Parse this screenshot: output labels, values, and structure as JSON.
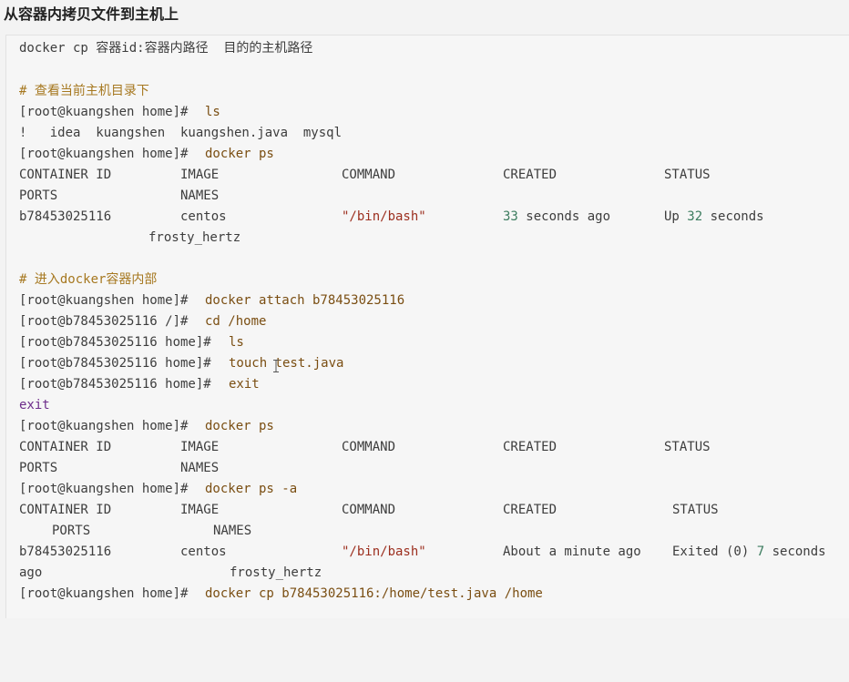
{
  "title": "从容器内拷贝文件到主机上",
  "syntax": "docker cp 容器id:容器内路径  目的的主机路径",
  "comment1": "# 查看当前主机目录下",
  "prompt_host": "[root@kuangshen home]#",
  "prompt_container_root": "[root@b78453025116 /]#",
  "prompt_container_home": "[root@b78453025116 home]#",
  "cmd_ls": "ls",
  "ls_output": "!   idea  kuangshen  kuangshen.java  mysql",
  "cmd_docker_ps": "docker ps",
  "table": {
    "h_container_id": "CONTAINER ID",
    "h_image": "IMAGE",
    "h_command": "COMMAND",
    "h_created": "CREATED",
    "h_status": "STATUS",
    "h_ports": "PORTS",
    "h_names": "NAMES"
  },
  "row1": {
    "id": "b78453025116",
    "image": "centos",
    "command": "\"/bin/bash\"",
    "created_num": "33",
    "created_rest": " seconds ago",
    "status_up": "Up ",
    "status_num": "32",
    "status_rest": " seconds",
    "name": "frosty_hertz"
  },
  "comment2": "# 进入docker容器内部",
  "cmd_attach": "docker attach b78453025116",
  "cmd_cd": "cd /home",
  "cmd_touch": "touch test.java",
  "cmd_exit": "exit",
  "exit_output": "exit",
  "cmd_docker_ps_a": "docker ps -a",
  "row2": {
    "id": "b78453025116",
    "image": "centos",
    "command": "\"/bin/bash\"",
    "created": "About a minute ago",
    "status_exited": "Exited (0) ",
    "status_num": "7",
    "status_rest": " seconds",
    "wrap": "ago",
    "name": "frosty_hertz"
  },
  "cmd_cp": "docker cp b78453025116:/home/test.java /home"
}
